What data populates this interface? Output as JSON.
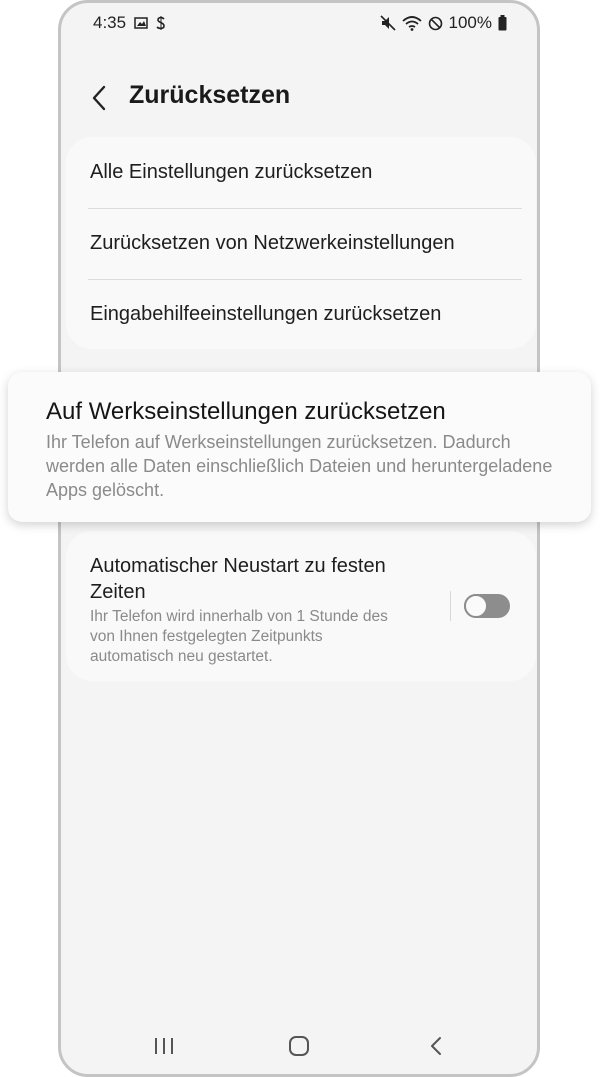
{
  "status_bar": {
    "time": "4:35",
    "battery": "100%",
    "icons_left": [
      "gallery-icon",
      "s-icon"
    ],
    "icons_right": [
      "mute-icon",
      "wifi-icon",
      "no-disturb-icon",
      "battery-icon"
    ]
  },
  "header": {
    "title": "Zurücksetzen",
    "back_icon": "chevron-left-icon"
  },
  "reset_options": [
    {
      "label": "Alle Einstellungen zurücksetzen"
    },
    {
      "label": "Zurücksetzen von Netzwerkeinstellungen"
    },
    {
      "label": "Eingabehilfeeinstellungen zurücksetzen"
    }
  ],
  "factory_reset": {
    "title": "Auf Werkseinstellungen zurücksetzen",
    "description": "Ihr Telefon auf Werkseinstellungen zurücksetzen. Dadurch werden alle Daten einschließlich Dateien und heruntergeladene Apps gelöscht."
  },
  "auto_restart": {
    "title": "Automatischer Neustart zu festen Zeiten",
    "description": "Ihr Telefon wird innerhalb von 1 Stunde des von Ihnen festgelegten Zeitpunkts automatisch neu gestartet.",
    "enabled": false
  },
  "nav_bar": {
    "icons": [
      "recent-apps-icon",
      "home-icon",
      "back-icon"
    ]
  },
  "colors": {
    "background": "#f4f4f4",
    "card": "#f9f9f9",
    "text_primary": "#1e1e1e",
    "text_secondary": "#8a8a8a",
    "toggle_off": "#8d8d8d"
  }
}
